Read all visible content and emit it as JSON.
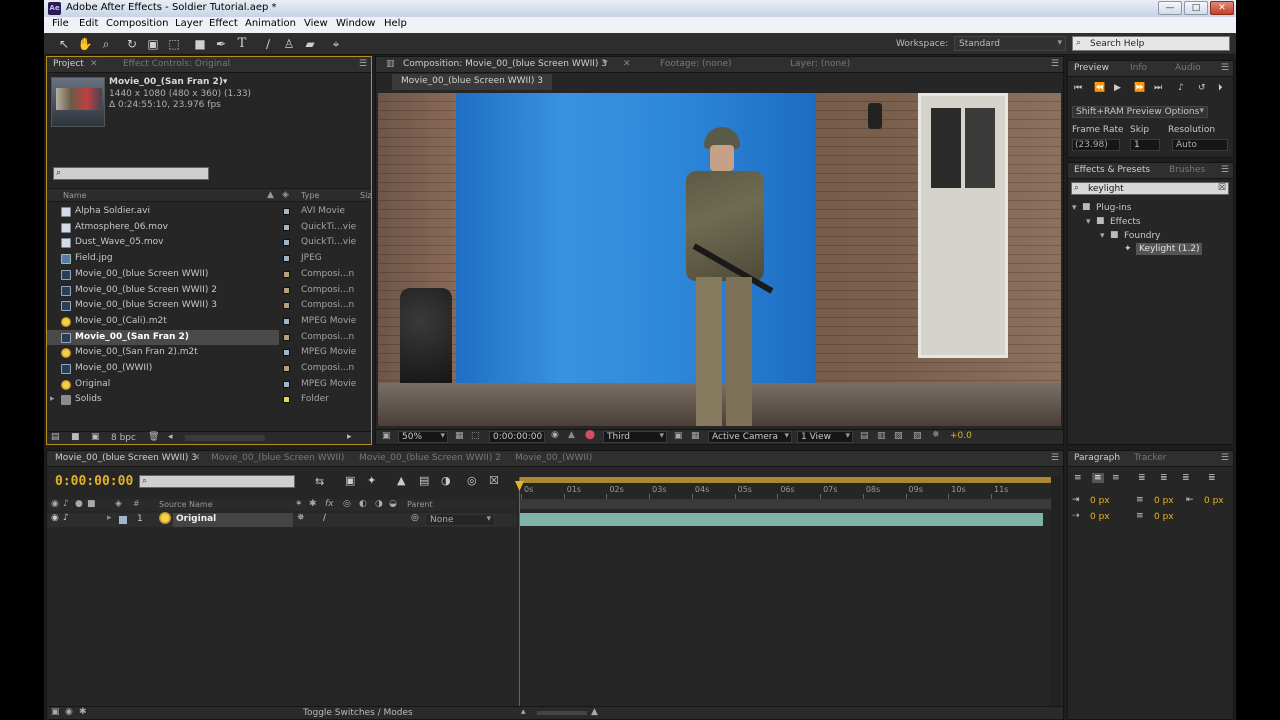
{
  "window": {
    "title": "Adobe After Effects - Soldier Tutorial.aep *",
    "app_icon": "Ae",
    "controls": [
      "—",
      "□",
      "✕"
    ]
  },
  "menu": [
    "File",
    "Edit",
    "Composition",
    "Layer",
    "Effect",
    "Animation",
    "View",
    "Window",
    "Help"
  ],
  "toolbar": {
    "tools": [
      "select-arrow-icon",
      "hand-icon",
      "zoom-icon",
      "rotate-icon",
      "camera-orbit-icon",
      "pan-behind-icon",
      "rectangle-mask-icon",
      "pen-icon",
      "text-icon",
      "brush-icon",
      "clone-stamp-icon",
      "eraser-icon",
      "puppet-pin-icon"
    ],
    "workspace_label": "Workspace:",
    "workspace_value": "Standard",
    "search_placeholder": "Search Help"
  },
  "project": {
    "tab_label": "Project",
    "effect_controls_label": "Effect Controls: Original",
    "selected_name": "Movie_00_(San Fran 2)▾",
    "selected_dims": "1440 x 1080  (480 x 360) (1.33)",
    "selected_duration": "Δ 0:24:55:10, 23.976 fps",
    "col_name": "Name",
    "col_type": "Type",
    "col_size": "Siz",
    "items": [
      {
        "name": "Alpha Soldier.avi",
        "type": "AVI Movie",
        "kind": "avi",
        "label_color": "#9fb5c9"
      },
      {
        "name": "Atmosphere_06.mov",
        "type": "QuickTi...vie",
        "kind": "avi",
        "label_color": "#9fb5c9"
      },
      {
        "name": "Dust_Wave_05.mov",
        "type": "QuickTi...vie",
        "kind": "avi",
        "label_color": "#9fb5c9"
      },
      {
        "name": "Field.jpg",
        "type": "JPEG",
        "kind": "jpg",
        "label_color": "#9fb5c9"
      },
      {
        "name": "Movie_00_(blue Screen WWII)",
        "type": "Composi...n",
        "kind": "comp",
        "label_color": "#b8a17c"
      },
      {
        "name": "Movie_00_(blue Screen WWII) 2",
        "type": "Composi...n",
        "kind": "comp",
        "label_color": "#b8a17c"
      },
      {
        "name": "Movie_00_(blue Screen WWII) 3",
        "type": "Composi...n",
        "kind": "comp",
        "label_color": "#b8a17c"
      },
      {
        "name": "Movie_00_(Cali).m2t",
        "type": "MPEG Movie",
        "kind": "mpg",
        "label_color": "#9fb5c9"
      },
      {
        "name": "Movie_00_(San Fran 2)",
        "type": "Composi...n",
        "kind": "comp",
        "label_color": "#b8a17c",
        "selected": true
      },
      {
        "name": "Movie_00_(San Fran 2).m2t",
        "type": "MPEG Movie",
        "kind": "mpg",
        "label_color": "#9fb5c9"
      },
      {
        "name": "Movie_00_(WWII)",
        "type": "Composi...n",
        "kind": "comp",
        "label_color": "#b8a17c"
      },
      {
        "name": "Original",
        "type": "MPEG Movie",
        "kind": "mpg",
        "label_color": "#9fb5c9"
      },
      {
        "name": "Solids",
        "type": "Folder",
        "kind": "fld",
        "label_color": "#e8d84a"
      }
    ],
    "bpc": "8 bpc"
  },
  "composition": {
    "tab_label": "Composition: Movie_00_(blue Screen WWII) 3",
    "footage_label": "Footage: (none)",
    "layer_label": "Layer: (none)",
    "subtab": "Movie_00_(blue Screen WWII) 3",
    "zoom": "50%",
    "timecode": "0:00:00:00",
    "resolution": "Third",
    "camera": "Active Camera",
    "views": "1 View",
    "exposure": "+0.0"
  },
  "preview": {
    "tabs": [
      "Preview",
      "Info",
      "Audio"
    ],
    "options": "Shift+RAM Preview Options",
    "frame_rate_label": "Frame Rate",
    "skip_label": "Skip",
    "resolution_label": "Resolution",
    "frame_rate": "(23.98)",
    "skip": "1",
    "resolution": "Auto"
  },
  "effects": {
    "tabs": [
      "Effects & Presets",
      "Brushes"
    ],
    "search": "keylight",
    "tree": [
      "Plug-ins",
      "Effects",
      "Foundry",
      "Keylight (1.2)"
    ]
  },
  "timeline": {
    "tabs": [
      "Movie_00_(blue Screen WWII) 3",
      "Movie_00_(blue Screen WWII)",
      "Movie_00_(blue Screen WWII) 2",
      "Movie_00_(WWII)"
    ],
    "timecode": "0:00:00:00",
    "col_source": "Source Name",
    "col_parent": "Parent",
    "col_hash": "#",
    "layer_num": "1",
    "layer_name": "Original",
    "parent_value": "None",
    "ruler": [
      "0s",
      "01s",
      "02s",
      "03s",
      "04s",
      "05s",
      "06s",
      "07s",
      "08s",
      "09s",
      "10s",
      "11s"
    ],
    "toggle_label": "Toggle Switches / Modes"
  },
  "paragraph": {
    "tabs": [
      "Paragraph",
      "Tracker"
    ],
    "values": [
      "0 px",
      "0 px",
      "0 px",
      "0 px",
      "0 px"
    ]
  }
}
